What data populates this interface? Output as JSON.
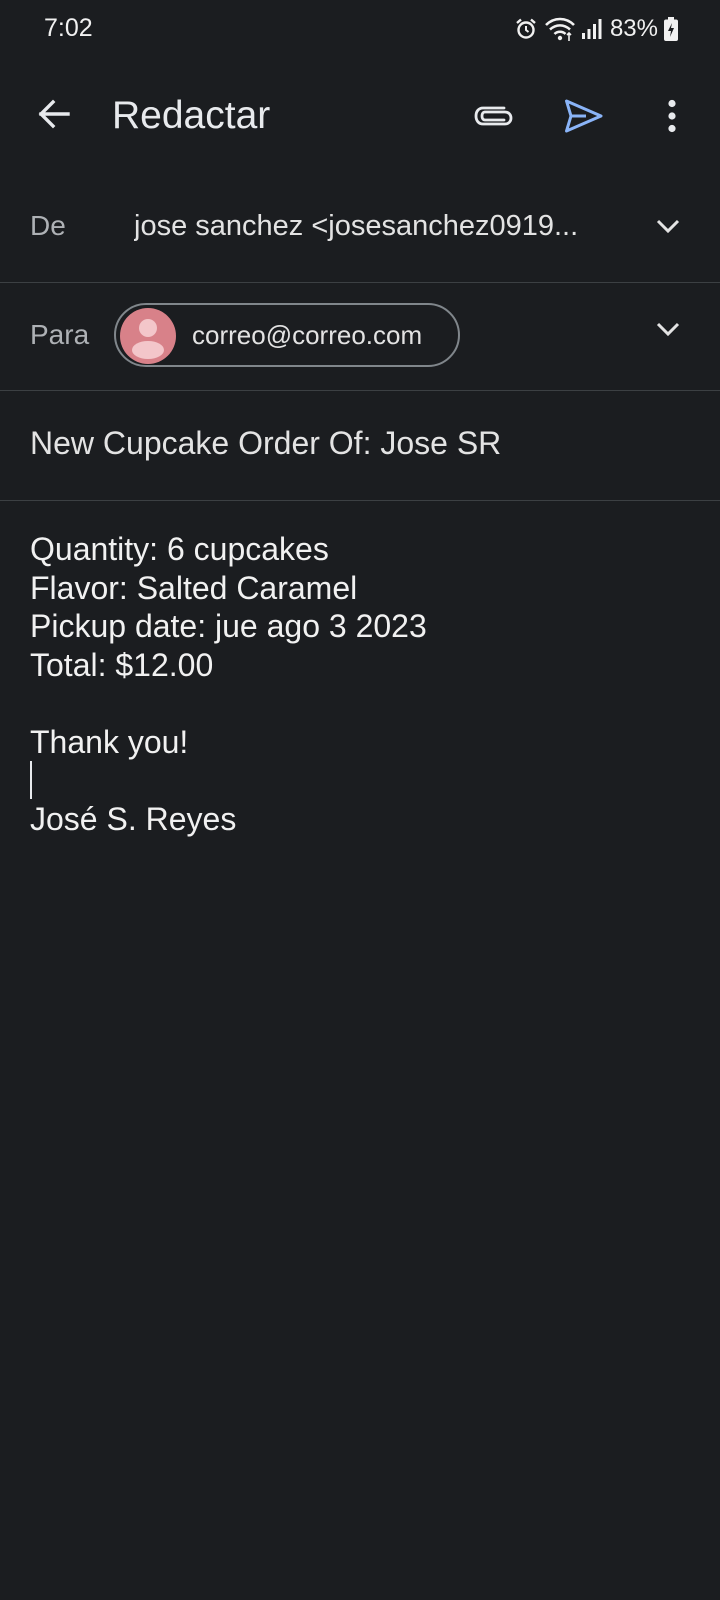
{
  "status_bar": {
    "time": "7:02",
    "battery": "83%",
    "icons": [
      "alarm-icon",
      "wifi-icon",
      "signal-icon",
      "battery-charging-icon"
    ]
  },
  "app_bar": {
    "title": "Redactar",
    "icons": [
      "back-arrow-icon",
      "attachment-icon",
      "send-icon",
      "more-vert-icon"
    ],
    "send_color": "#8ab4f8"
  },
  "compose": {
    "from_label": "De",
    "from_value": "jose sanchez  <josesanchez0919...",
    "to_label": "Para",
    "to_chip": "correo@correo.com",
    "subject": "New Cupcake Order Of: Jose SR",
    "body_lines": [
      "Quantity: 6 cupcakes",
      "Flavor: Salted Caramel",
      "Pickup date: jue ago 3 2023",
      "Total: $12.00",
      "",
      "Thank you!",
      "",
      "José S. Reyes"
    ]
  },
  "colors": {
    "background": "#1b1d20",
    "divider": "#3c4043",
    "avatar": "#d88189",
    "accent": "#8ab4f8"
  }
}
